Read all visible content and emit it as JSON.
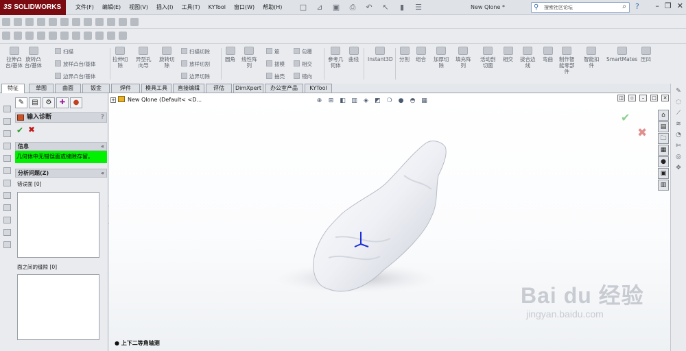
{
  "app": {
    "logo_text": "SOLIDWORKS",
    "logo_prefix": "3S",
    "menu": [
      "文件(F)",
      "编辑(E)",
      "视图(V)",
      "插入(I)",
      "工具(T)",
      "KYTool",
      "窗口(W)",
      "帮助(H)"
    ],
    "doc_title": "New Qlone *",
    "search_placeholder": "搜索社区论坛",
    "help_icon": "?"
  },
  "command_manager": {
    "large": [
      {
        "label": "拉伸凸\n台/基体",
        "icon": "extrude-boss-icon"
      },
      {
        "label": "旋转凸\n台/基体",
        "icon": "revolve-boss-icon"
      },
      {
        "label": "拉伸切\n除",
        "icon": "extrude-cut-icon"
      },
      {
        "label": "异型孔\n向导",
        "icon": "hole-wizard-icon"
      },
      {
        "label": "旋转切\n除",
        "icon": "revolve-cut-icon"
      },
      {
        "label": "圆角",
        "icon": "fillet-icon"
      },
      {
        "label": "线性阵\n列",
        "icon": "linear-pattern-icon"
      },
      {
        "label": "参考几\n何体",
        "icon": "reference-geometry-icon"
      },
      {
        "label": "曲线",
        "icon": "curves-icon"
      },
      {
        "label": "Instant3D",
        "icon": "instant3d-icon"
      },
      {
        "label": "分割",
        "icon": "split-icon"
      },
      {
        "label": "组合",
        "icon": "combine-icon"
      },
      {
        "label": "加厚切\n除",
        "icon": "thicken-cut-icon"
      },
      {
        "label": "填充阵\n列",
        "icon": "fill-pattern-icon"
      },
      {
        "label": "活动剖\n切面",
        "icon": "live-section-icon"
      },
      {
        "label": "相交",
        "icon": "intersect-icon"
      },
      {
        "label": "拔合边\n线",
        "icon": "wrap-edge-icon"
      },
      {
        "label": "弯曲",
        "icon": "flex-icon"
      },
      {
        "label": "制作智\n能零部\n件",
        "icon": "smart-component-icon"
      },
      {
        "label": "智能扣\n件",
        "icon": "smart-fasteners-icon"
      },
      {
        "label": "SmartMates",
        "icon": "smartmates-icon"
      },
      {
        "label": "压凹",
        "icon": "indent-icon"
      }
    ],
    "small": [
      {
        "label": "扫描",
        "icon": "swept-boss-icon"
      },
      {
        "label": "放样凸台/基体",
        "icon": "loft-boss-icon"
      },
      {
        "label": "边界凸台/基体",
        "icon": "boundary-boss-icon"
      },
      {
        "label": "扫描切除",
        "icon": "swept-cut-icon"
      },
      {
        "label": "放样切割",
        "icon": "loft-cut-icon"
      },
      {
        "label": "边界切除",
        "icon": "boundary-cut-icon"
      },
      {
        "label": "筋",
        "icon": "rib-icon"
      },
      {
        "label": "拔模",
        "icon": "draft-icon"
      },
      {
        "label": "抽壳",
        "icon": "shell-icon"
      },
      {
        "label": "包覆",
        "icon": "wrap-icon"
      },
      {
        "label": "相交",
        "icon": "intersect-small-icon"
      },
      {
        "label": "镜向",
        "icon": "mirror-icon"
      }
    ]
  },
  "tabs": [
    "特征",
    "草图",
    "曲面",
    "钣金",
    "焊件",
    "模具工具",
    "直接编辑",
    "评估",
    "DimXpert",
    "办公室产品",
    "KYTool"
  ],
  "property_manager": {
    "title": "输入诊断",
    "help": "?",
    "section_info": "信息",
    "info_message": "几何体中无错误面或缝隙存留。",
    "section_analysis": "分析问题(Z)",
    "faulty_faces_label": "错误面",
    "faulty_faces_count": "[0]",
    "gaps_label": "面之间的缝隙",
    "gaps_count": "[0]",
    "collapse": "«"
  },
  "viewport": {
    "tree_label": "New Qlone  (Default< <D...",
    "view_orientation": "上下二等角轴测",
    "watermark_main": "Bai du 经验",
    "watermark_sub": "jingyan.baidu.com",
    "model_color": "#f4f5f8"
  },
  "colors": {
    "brand": "#7a0b10",
    "info_bg": "#00f200",
    "ok": "#2b9a2b",
    "cancel": "#c31a1a"
  }
}
